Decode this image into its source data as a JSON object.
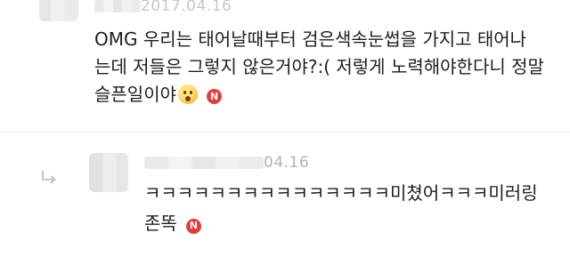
{
  "top_comment": {
    "date": "2017.04.16",
    "lines": [
      "OMG 우리는 태어날때부터 검은색속눈썹을 가지고 태어나",
      "는데 저들은 그렇지 않은거야?:( 저렇게 노력해야한다니 정말",
      "슬픈일이야"
    ],
    "emoji": "astonished-face-emoji",
    "new_badge": "N"
  },
  "reply_comment": {
    "date": "04.16",
    "lines": [
      "ㅋㅋㅋㅋㅋㅋㅋㅋㅋㅋㅋㅋㅋㅋㅋ미쳤어ㅋㅋㅋ미러링",
      "존똑"
    ],
    "new_badge": "N",
    "reply_icon": "reply-arrow-icon"
  },
  "colors": {
    "text": "#1e1e1e",
    "date": "#b3b3b3",
    "badge": "#e83b3b",
    "divider": "#e6e6e6"
  }
}
